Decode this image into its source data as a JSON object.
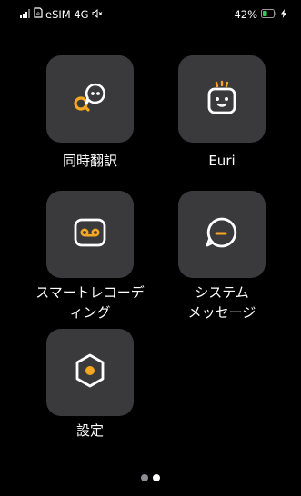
{
  "status_bar": {
    "carrier": "eSIM 4G",
    "battery_percent": "42%",
    "icons": [
      "signal-icon",
      "esim-icon",
      "mute-icon",
      "battery-icon",
      "charging-icon"
    ],
    "battery_level": 0.42
  },
  "colors": {
    "background": "#000000",
    "tile": "#3a3a3c",
    "accent": "#f5a623",
    "battery_green": "#34c759"
  },
  "apps": [
    {
      "label": "同時翻訳",
      "icon": "translation-bubbles-icon"
    },
    {
      "label": "Euri",
      "icon": "euri-robot-icon"
    },
    {
      "label_line1": "スマートレコーデ",
      "label_line2": "ィング",
      "icon": "voice-recorder-icon"
    },
    {
      "label_line1": "システム",
      "label_line2": "メッセージ",
      "icon": "system-message-icon"
    },
    {
      "label": "設定",
      "icon": "settings-hexagon-icon"
    }
  ],
  "pagination": {
    "pages": 2,
    "current_page": 2
  }
}
